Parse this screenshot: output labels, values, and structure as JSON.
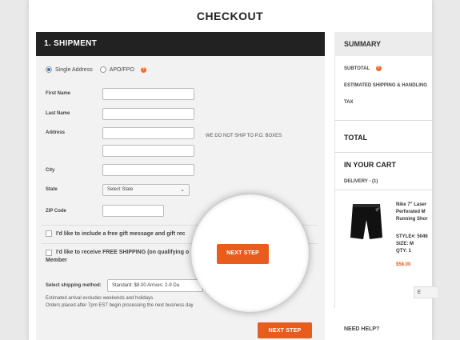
{
  "page_title": "CHECKOUT",
  "shipment": {
    "header": "1. SHIPMENT",
    "address_options": [
      "Single Address",
      "APO/FPO"
    ],
    "fields": {
      "first_name": "First Name",
      "last_name": "Last Name",
      "address": "Address",
      "city": "City",
      "state": "State",
      "zip": "ZIP Code"
    },
    "state_placeholder": "Select State",
    "po_box_note": "WE DO NOT SHIP TO P.O. BOXES",
    "gift_message_label": "I'd like to include a free gift message and gift rec",
    "free_shipping_label_line1": "I'd like to receive FREE SHIPPING (on qualifying o",
    "free_shipping_label_line2": "Member",
    "shipping_method_label": "Select shipping method:",
    "shipping_method_value": "Standard: $8.00  Arrives: 2-9 Da",
    "note_line1": "Estimated arrival excludes weekends and holidays.",
    "note_line2": "Orders placed after 7pm EST begin processing the next business day",
    "next_step_label": "NEXT STEP",
    "next_step_magnified_label": "NEXT STEP"
  },
  "summary": {
    "header": "SUMMARY",
    "subtotal_label": "SUBTOTAL",
    "shipping_label": "ESTIMATED SHIPPING & HANDLING",
    "tax_label": "TAX",
    "total_label": "TOTAL",
    "cart_header": "IN YOUR CART",
    "delivery_label": "DELIVERY - (1)",
    "product": {
      "name_line1": "Nike 7\" Laser",
      "name_line2": "Perforated M",
      "name_line3": "Running Shor",
      "style": "STYLE#: 5046",
      "size": "SIZE:  M",
      "qty": "QTY: 1",
      "price": "$58.00"
    },
    "mini_button_label": "E",
    "help_header": "NEED HELP?"
  },
  "colors": {
    "accent": "#e85d1e",
    "header_dark": "#222222",
    "radio_selected": "#3a6fb0"
  }
}
